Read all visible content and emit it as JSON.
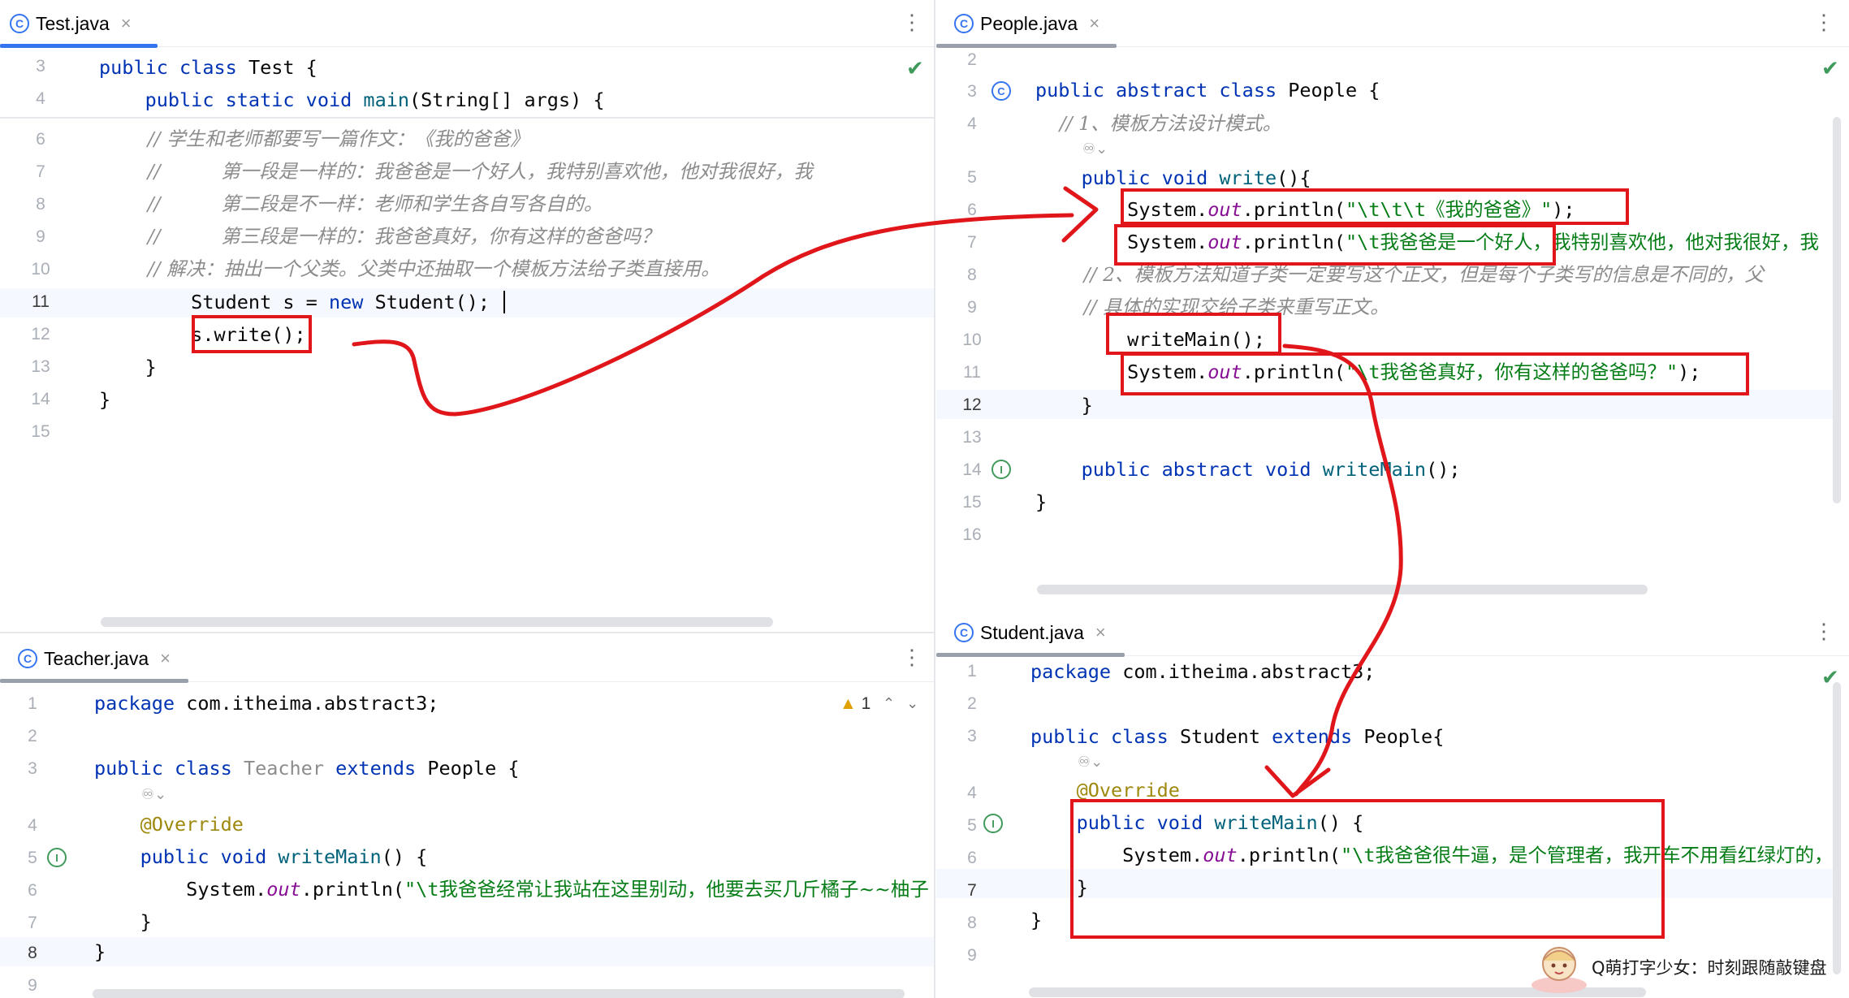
{
  "colors": {
    "keyword": "#0033b3",
    "comment": "#8c8c8c",
    "string": "#067d17",
    "annotation": "#9e880d",
    "field": "#871094",
    "highlight_box": "#e0161b",
    "arrow": "#e0161b",
    "tab_active": "#3574f0"
  },
  "test_pane": {
    "tab": {
      "icon": "class-icon",
      "title": "Test.java",
      "close": "×"
    },
    "menu": "⋮",
    "lines": [
      {
        "num": "3",
        "code": "public class Test {"
      },
      {
        "num": "4",
        "code": "    public static void main(String[] args) {"
      },
      {
        "num": "6",
        "code": "        // 学生和老师都要写一篇作文：《我的爸爸》"
      },
      {
        "num": "7",
        "code": "        //          第一段是一样的：我爸爸是一个好人，我特别喜欢他，他对我很好，我"
      },
      {
        "num": "8",
        "code": "        //          第二段是不一样：老师和学生各自写各自的。"
      },
      {
        "num": "9",
        "code": "        //          第三段是一样的：我爸爸真好，你有这样的爸爸吗？"
      },
      {
        "num": "10",
        "code": "        // 解决：抽出一个父类。父类中还抽取一个模板方法给子类直接用。"
      },
      {
        "num": "11",
        "code": "        Student s = new Student();"
      },
      {
        "num": "12",
        "code": "        s.write();"
      },
      {
        "num": "13",
        "code": "    }"
      },
      {
        "num": "14",
        "code": "}"
      },
      {
        "num": "15",
        "code": ""
      }
    ]
  },
  "people_pane": {
    "tab": {
      "icon": "class-icon",
      "title": "People.java",
      "close": "×"
    },
    "menu": "⋮",
    "lines": [
      {
        "num": "2",
        "code": ""
      },
      {
        "num": "3",
        "code": "public abstract class People {"
      },
      {
        "num": "4",
        "code": "    // 1、模板方法设计模式。"
      },
      {
        "num": "5",
        "code": "    public void write(){"
      },
      {
        "num": "6",
        "code": "        System.out.println(\"\\t\\t\\t《我的爸爸》\");"
      },
      {
        "num": "7",
        "code": "        System.out.println(\"\\t我爸爸是一个好人，我特别喜欢他，他对我很好，我"
      },
      {
        "num": "8",
        "code": "        // 2、模板方法知道子类一定要写这个正文，但是每个子类写的信息是不同的，父"
      },
      {
        "num": "9",
        "code": "        // 具体的实现交给子类来重写正文。"
      },
      {
        "num": "10",
        "code": "        writeMain();"
      },
      {
        "num": "11",
        "code": "        System.out.println(\"\\t我爸爸真好，你有这样的爸爸吗？\");"
      },
      {
        "num": "12",
        "code": "    }"
      },
      {
        "num": "13",
        "code": ""
      },
      {
        "num": "14",
        "code": "    public abstract void writeMain();"
      },
      {
        "num": "15",
        "code": "}"
      },
      {
        "num": "16",
        "code": ""
      }
    ]
  },
  "teacher_pane": {
    "tab": {
      "icon": "class-icon",
      "title": "Teacher.java",
      "close": "×"
    },
    "menu": "⋮",
    "warnings": {
      "icon": "warning-icon",
      "count": "1",
      "up": "^",
      "down": "v"
    },
    "lines": [
      {
        "num": "1",
        "code": "package com.itheima.abstract3;"
      },
      {
        "num": "2",
        "code": ""
      },
      {
        "num": "3",
        "code": "public class Teacher extends People {"
      },
      {
        "num": "4",
        "code": "    @Override"
      },
      {
        "num": "5",
        "code": "    public void writeMain() {"
      },
      {
        "num": "6",
        "code": "        System.out.println(\"\\t我爸爸经常让我站在这里别动，他要去买几斤橘子~~柚子"
      },
      {
        "num": "7",
        "code": "    }"
      },
      {
        "num": "8",
        "code": "}"
      },
      {
        "num": "9",
        "code": ""
      }
    ]
  },
  "student_pane": {
    "tab": {
      "icon": "class-icon",
      "title": "Student.java",
      "close": "×"
    },
    "menu": "⋮",
    "lines": [
      {
        "num": "1",
        "code": "package com.itheima.abstract3;"
      },
      {
        "num": "2",
        "code": ""
      },
      {
        "num": "3",
        "code": "public class Student extends People{"
      },
      {
        "num": "4",
        "code": "    @Override"
      },
      {
        "num": "5",
        "code": "    public void writeMain() {"
      },
      {
        "num": "6",
        "code": "        System.out.println(\"\\t我爸爸很牛逼，是个管理者，我开车不用看红绿灯的，"
      },
      {
        "num": "7",
        "code": "    }"
      },
      {
        "num": "8",
        "code": "}"
      },
      {
        "num": "9",
        "code": ""
      }
    ]
  },
  "watermark": {
    "text": "Q萌打字少女：时刻跟随敲键盘"
  }
}
